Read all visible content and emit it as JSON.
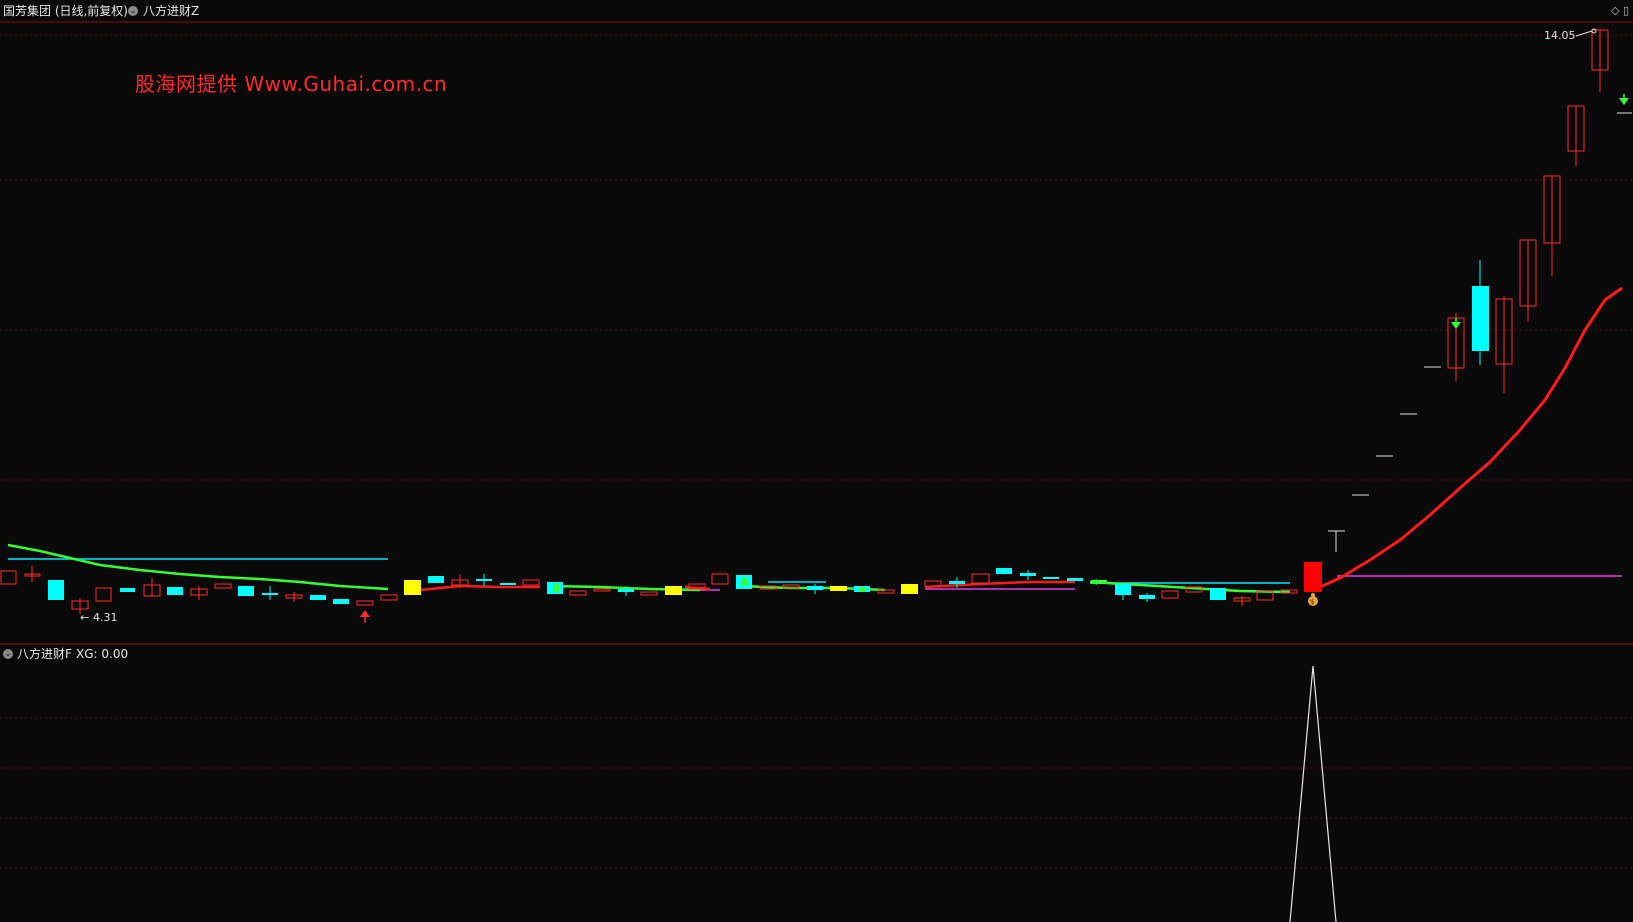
{
  "header": {
    "stock_label": "国芳集团 (日线,前复权)",
    "indicator_label": "八方进财Z",
    "collapse_glyph": "⌄",
    "corner_icons": "◇ ▯"
  },
  "watermark": {
    "text": "股海网提供  Www.Guhai.com.cn"
  },
  "price_labels": {
    "high": "14.05",
    "low": "4.31"
  },
  "sub_panel": {
    "indicator_label": "八方进财F",
    "xg_label": "XG: 0.00",
    "collapse_glyph": "⌄"
  },
  "colors": {
    "background": "#0a0a0a",
    "grid": "#5a0a0a",
    "up_candle": "#ff2a2a",
    "down_candle": "#00ffff",
    "special_candle": "#ffff00",
    "green_line": "#33ff33",
    "red_line": "#ff1a1a",
    "cyan_line": "#00e5ff",
    "magenta_line": "#e040e0",
    "watermark": "#ff2a2a"
  },
  "icons": {
    "up_arrow": "red-up-arrow-icon",
    "down_arrow": "green-down-arrow-icon",
    "money_bag": "money-bag-icon"
  },
  "chart_data": {
    "type": "candlestick",
    "price_range": [
      4.31,
      14.05
    ],
    "grid": true,
    "sub_chart": {
      "type": "line",
      "indicator": "XG",
      "current_value": 0.0,
      "signal_spike_at_candle_index": 53
    }
  }
}
